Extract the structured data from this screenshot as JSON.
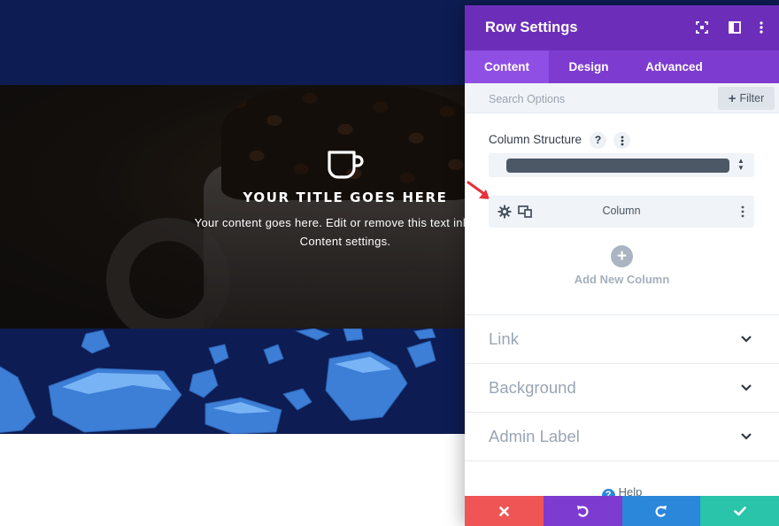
{
  "hero": {
    "blurb_title": "YOUR TITLE GOES HERE",
    "blurb_body_line1": "Your content goes here. Edit or remove this text inline or",
    "blurb_body_line2": "Content settings.",
    "icon": "coffee-cup-icon"
  },
  "modal": {
    "title": "Row Settings",
    "header_icons": [
      "fullscreen-icon",
      "split-view-icon",
      "more-vertical-icon"
    ],
    "tabs": [
      {
        "label": "Content",
        "active": true
      },
      {
        "label": "Design",
        "active": false
      },
      {
        "label": "Advanced",
        "active": false
      }
    ],
    "search": {
      "placeholder": "Search Options"
    },
    "filter_label": "Filter",
    "column_structure": {
      "label": "Column Structure",
      "help_glyph": "?"
    },
    "column": {
      "label": "Column"
    },
    "add_column_label": "Add New Column",
    "sections": [
      {
        "label": "Link"
      },
      {
        "label": "Background"
      },
      {
        "label": "Admin Label"
      }
    ],
    "help_label": "Help"
  },
  "colors": {
    "header": "#6c2eb9",
    "tabs": "#7d3bcf",
    "active_tab": "#8f4fe4",
    "cancel": "#ef5555",
    "undo": "#7e3bd0",
    "redo": "#2b87da",
    "save": "#29c4a9",
    "page_navy": "#0d1c52",
    "annotation_arrow": "#e8303a"
  }
}
